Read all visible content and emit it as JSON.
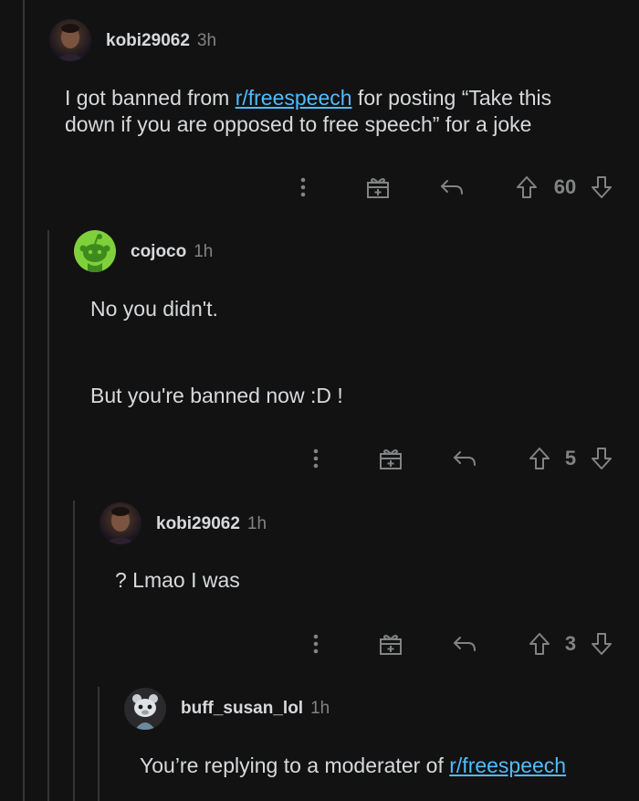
{
  "comments": [
    {
      "username": "kobi29062",
      "time": "3h",
      "text_before": "I got banned from ",
      "link": "r/freespeech",
      "text_after": " for posting “Take this down if you are opposed to free speech” for a joke",
      "votes": "60"
    },
    {
      "username": "cojoco",
      "time": "1h",
      "line1": "No you didn't.",
      "line2": "But you're banned now :D !",
      "votes": "5"
    },
    {
      "username": "kobi29062",
      "time": "1h",
      "text": "? Lmao I was",
      "votes": "3"
    },
    {
      "username": "buff_susan_lol",
      "time": "1h",
      "text_before": "You’re replying to a moderater of ",
      "link": "r/freespeech"
    }
  ],
  "colors": {
    "background": "#121212",
    "text": "#d7dadc",
    "muted": "#818384",
    "link": "#4fbcff",
    "thread_line": "#343536",
    "snoo_green": "#7fd13b"
  },
  "icons": [
    "more-vertical-icon",
    "gift-award-icon",
    "reply-icon",
    "upvote-icon",
    "downvote-icon"
  ]
}
